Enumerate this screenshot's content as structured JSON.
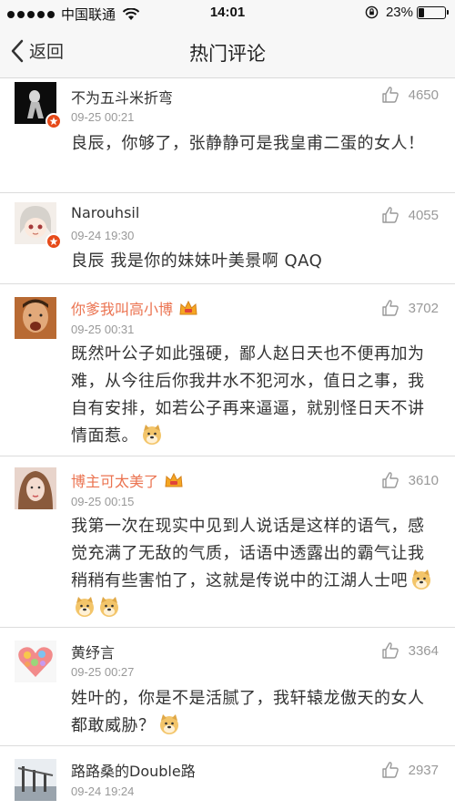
{
  "status": {
    "carrier": "中国联通",
    "time": "14:01",
    "battery": "23%",
    "battery_level": 0.23
  },
  "nav": {
    "back_label": "返回",
    "title": "热门评论"
  },
  "comments": [
    {
      "name": "不为五斗米折弯",
      "time": "09-25 00:21",
      "likes": "4650",
      "text": "良辰，你够了，张静静可是我皇甫二蛋的女人！"
    },
    {
      "name": "Narouhsil",
      "time": "09-24 19:30",
      "likes": "4055",
      "text": "良辰 我是你的妹妹叶美景啊 QAQ"
    },
    {
      "name": "你爹我叫高小博",
      "time": "09-25 00:31",
      "likes": "3702",
      "text": "既然叶公子如此强硬，鄙人赵日天也不便再加为难，从今往后你我井水不犯河水，值日之事，我自有安排，如若公子再来逼逼，就别怪日天不讲情面惹。"
    },
    {
      "name": "博主可太美了",
      "time": "09-25 00:15",
      "likes": "3610",
      "text": "我第一次在现实中见到人说话是这样的语气，感觉充满了无敌的气质，话语中透露出的霸气让我稍稍有些害怕了，这就是传说中的江湖人士吧"
    },
    {
      "name": "黄纾言",
      "time": "09-25 00:27",
      "likes": "3364",
      "text": "姓叶的，你是不是活腻了，我轩辕龙傲天的女人都敢威胁？"
    },
    {
      "name": "路路桑的Double路",
      "time": "09-24 19:24",
      "likes": "2937",
      "text": ""
    }
  ]
}
